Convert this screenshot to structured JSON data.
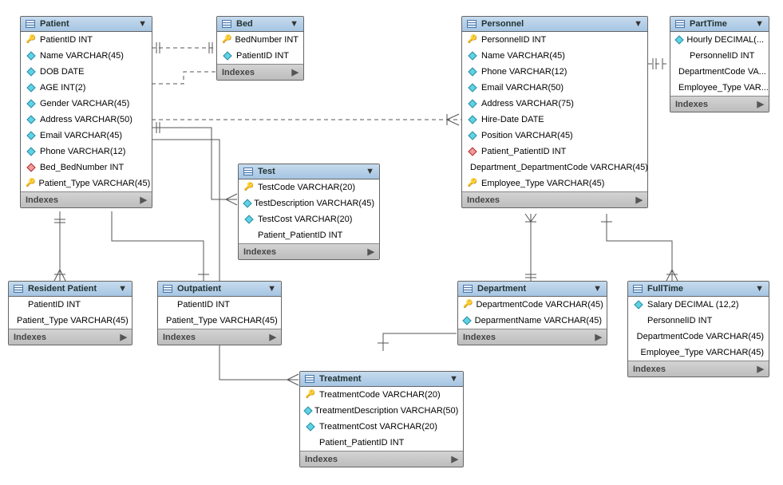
{
  "labels": {
    "indexes": "Indexes"
  },
  "entities": {
    "patient": {
      "title": "Patient",
      "fields": [
        {
          "icon": "key",
          "text": "PatientID INT"
        },
        {
          "icon": "diamond",
          "text": "Name VARCHAR(45)"
        },
        {
          "icon": "diamond",
          "text": "DOB DATE"
        },
        {
          "icon": "diamond",
          "text": "AGE INT(2)"
        },
        {
          "icon": "diamond",
          "text": "Gender VARCHAR(45)"
        },
        {
          "icon": "diamond",
          "text": "Address VARCHAR(50)"
        },
        {
          "icon": "diamond",
          "text": "Email VARCHAR(45)"
        },
        {
          "icon": "diamond",
          "text": "Phone VARCHAR(12)"
        },
        {
          "icon": "red",
          "text": "Bed_BedNumber INT"
        },
        {
          "icon": "key",
          "text": "Patient_Type VARCHAR(45)"
        }
      ]
    },
    "bed": {
      "title": "Bed",
      "fields": [
        {
          "icon": "key",
          "text": "BedNumber INT"
        },
        {
          "icon": "diamond",
          "text": "PatientID INT"
        }
      ]
    },
    "personnel": {
      "title": "Personnel",
      "fields": [
        {
          "icon": "key",
          "text": "PersonnelID INT"
        },
        {
          "icon": "diamond",
          "text": "Name VARCHAR(45)"
        },
        {
          "icon": "diamond",
          "text": "Phone VARCHAR(12)"
        },
        {
          "icon": "diamond",
          "text": "Email VARCHAR(50)"
        },
        {
          "icon": "diamond",
          "text": "Address VARCHAR(75)"
        },
        {
          "icon": "diamond",
          "text": "Hire-Date DATE"
        },
        {
          "icon": "diamond",
          "text": "Position VARCHAR(45)"
        },
        {
          "icon": "red",
          "text": "Patient_PatientID INT"
        },
        {
          "icon": "none",
          "text": "Department_DepartmentCode VARCHAR(45)"
        },
        {
          "icon": "key",
          "text": "Employee_Type VARCHAR(45)"
        }
      ]
    },
    "parttime": {
      "title": "PartTime",
      "fields": [
        {
          "icon": "diamond",
          "text": "Hourly DECIMAL(..."
        },
        {
          "icon": "none",
          "text": "PersonnelID INT"
        },
        {
          "icon": "none",
          "text": "DepartmentCode VA..."
        },
        {
          "icon": "none",
          "text": "Employee_Type VAR..."
        }
      ]
    },
    "test": {
      "title": "Test",
      "fields": [
        {
          "icon": "key",
          "text": "TestCode VARCHAR(20)"
        },
        {
          "icon": "diamond",
          "text": "TestDescription VARCHAR(45)"
        },
        {
          "icon": "diamond",
          "text": "TestCost VARCHAR(20)"
        },
        {
          "icon": "none",
          "text": "Patient_PatientID INT"
        }
      ]
    },
    "residentpatient": {
      "title": "Resident Patient",
      "fields": [
        {
          "icon": "none",
          "text": "PatientID INT"
        },
        {
          "icon": "none",
          "text": "Patient_Type VARCHAR(45)"
        }
      ]
    },
    "outpatient": {
      "title": "Outpatient",
      "fields": [
        {
          "icon": "none",
          "text": "PatientID INT"
        },
        {
          "icon": "none",
          "text": "Patient_Type VARCHAR(45)"
        }
      ]
    },
    "department": {
      "title": "Department",
      "fields": [
        {
          "icon": "key",
          "text": "DepartmentCode VARCHAR(45)"
        },
        {
          "icon": "diamond",
          "text": "DeparmentName VARCHAR(45)"
        }
      ]
    },
    "fulltime": {
      "title": "FullTime",
      "fields": [
        {
          "icon": "diamond",
          "text": "Salary DECIMAL (12,2)"
        },
        {
          "icon": "none",
          "text": "PersonnelID INT"
        },
        {
          "icon": "none",
          "text": "DepartmentCode VARCHAR(45)"
        },
        {
          "icon": "none",
          "text": "Employee_Type VARCHAR(45)"
        }
      ]
    },
    "treatment": {
      "title": "Treatment",
      "fields": [
        {
          "icon": "key",
          "text": "TreatmentCode VARCHAR(20)"
        },
        {
          "icon": "diamond",
          "text": "TreatmentDescription VARCHAR(50)"
        },
        {
          "icon": "diamond",
          "text": "TreatmentCost VARCHAR(20)"
        },
        {
          "icon": "none",
          "text": "Patient_PatientID INT"
        }
      ]
    }
  }
}
